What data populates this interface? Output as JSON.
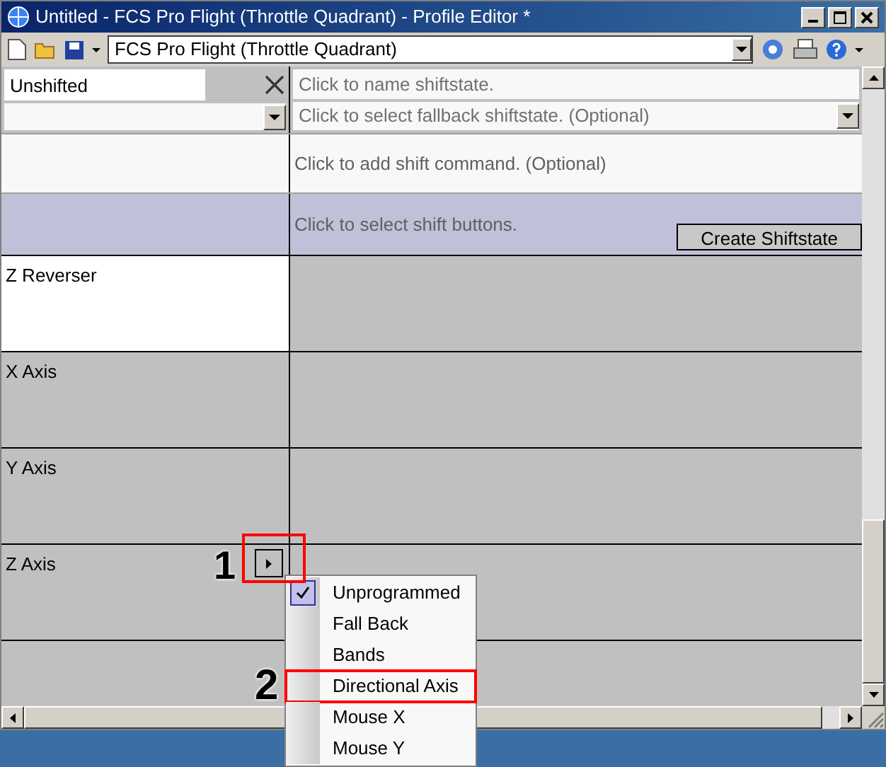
{
  "window": {
    "title": "Untitled - FCS Pro Flight (Throttle Quadrant) - Profile Editor *"
  },
  "toolbar": {
    "profile": "FCS Pro Flight (Throttle Quadrant)"
  },
  "shiftstate": {
    "name": "Unshifted",
    "name_placeholder": "Click to name shiftstate.",
    "fallback_placeholder": "Click to select fallback shiftstate. (Optional)",
    "command_placeholder": "Click to add shift command. (Optional)",
    "buttons_placeholder": "Click to select shift buttons.",
    "create_button": "Create Shiftstate"
  },
  "axes": [
    {
      "label": "Z Reverser",
      "selected": true,
      "menu_button": false
    },
    {
      "label": "X Axis",
      "selected": false,
      "menu_button": false
    },
    {
      "label": "Y Axis",
      "selected": false,
      "menu_button": false
    },
    {
      "label": "Z Axis",
      "selected": false,
      "menu_button": true
    }
  ],
  "context_menu": [
    {
      "label": "Unprogrammed",
      "checked": true,
      "highlighted": false
    },
    {
      "label": "Fall Back",
      "checked": false,
      "highlighted": false
    },
    {
      "label": "Bands",
      "checked": false,
      "highlighted": false
    },
    {
      "label": "Directional Axis",
      "checked": false,
      "highlighted": true
    },
    {
      "label": "Mouse X",
      "checked": false,
      "highlighted": false
    },
    {
      "label": "Mouse Y",
      "checked": false,
      "highlighted": false
    }
  ],
  "annotations": [
    "1",
    "2"
  ]
}
